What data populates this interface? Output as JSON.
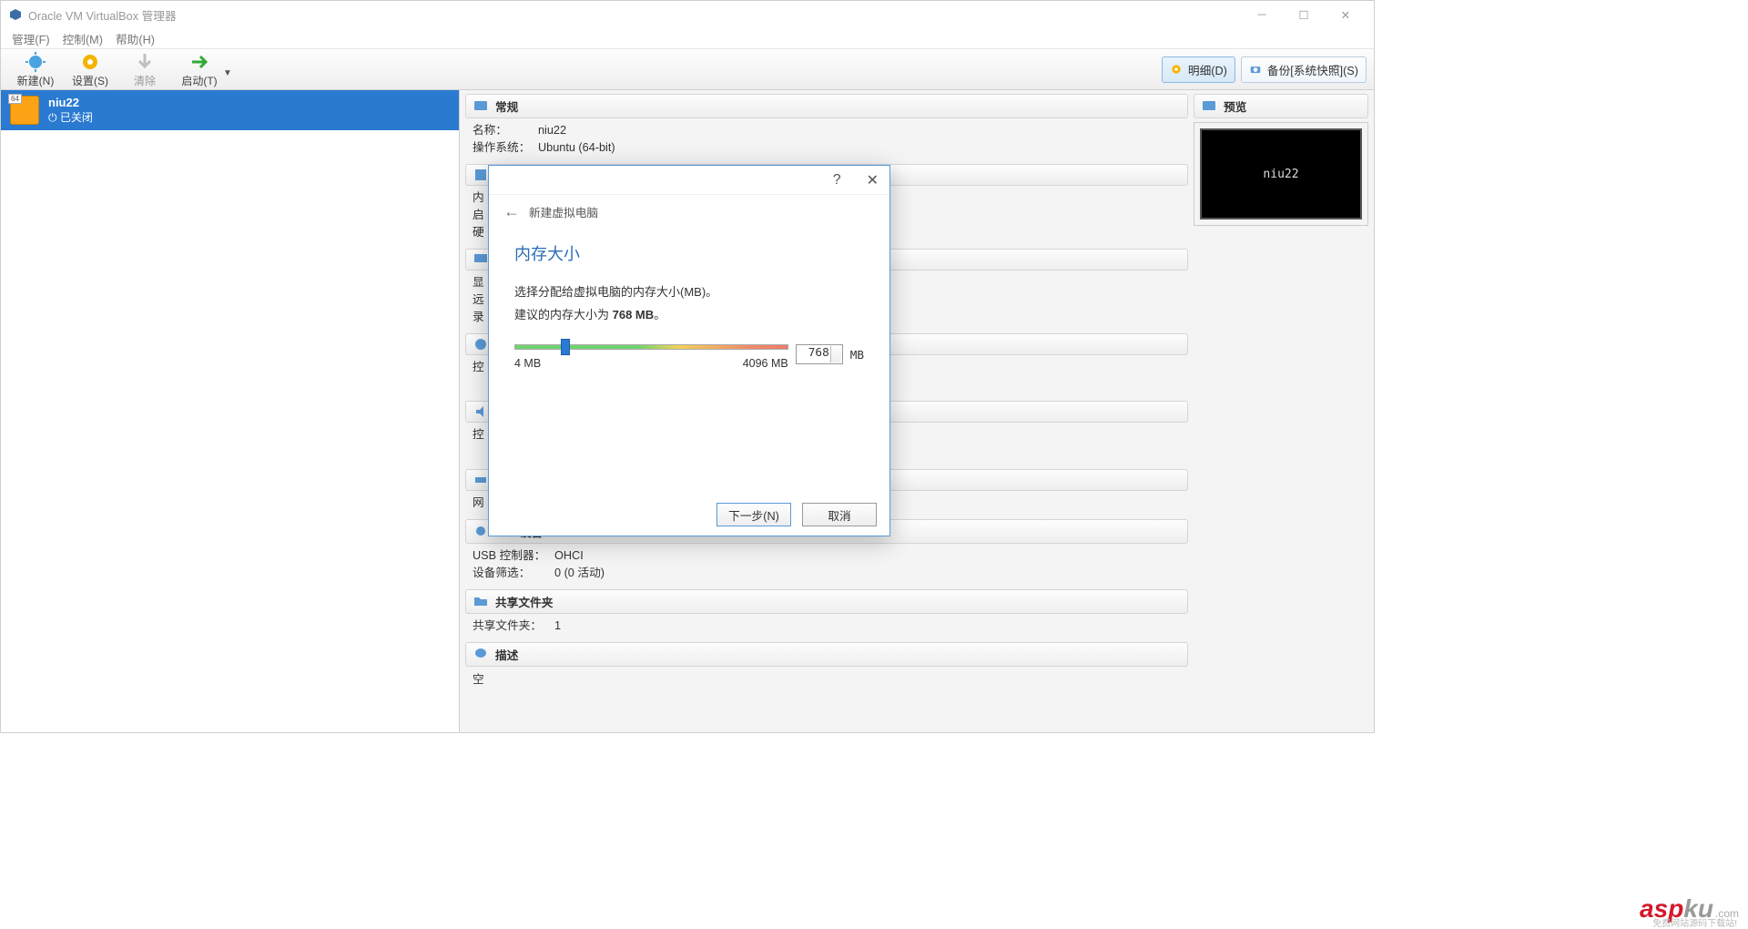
{
  "titlebar": {
    "title": "Oracle VM VirtualBox 管理器"
  },
  "menubar": {
    "items": [
      "管理(F)",
      "控制(M)",
      "帮助(H)"
    ]
  },
  "toolbar": {
    "new": "新建(N)",
    "settings": "设置(S)",
    "discard": "清除",
    "start": "启动(T)",
    "details": "明细(D)",
    "snapshots": "备份[系统快照](S)"
  },
  "vm": {
    "name": "niu22",
    "state": "⏻ 已关闭"
  },
  "general": {
    "header": "常规",
    "name_k": "名称：",
    "name_v": "niu22",
    "os_k": "操作系统：",
    "os_v": "Ubuntu (64-bit)"
  },
  "partials": {
    "sys": "内",
    "sys2": "启",
    "sys3": "硬",
    "disp": "显",
    "disp2": "远",
    "disp3": "录",
    "stor": "控",
    "aud": "控",
    "net": "网"
  },
  "usb": {
    "header": "USB设备",
    "ctrl_k": "USB 控制器：",
    "ctrl_v": "OHCI",
    "filter_k": "设备筛选：",
    "filter_v": "0 (0 活动)"
  },
  "shared": {
    "header": "共享文件夹",
    "k": "共享文件夹：",
    "v": "1"
  },
  "desc": {
    "header": "描述",
    "v": "空"
  },
  "preview": {
    "header": "预览",
    "name": "niu22"
  },
  "dialog": {
    "crumb": "新建虚拟电脑",
    "title": "内存大小",
    "line1": "选择分配给虚拟电脑的内存大小(MB)。",
    "line2a": "建议的内存大小为 ",
    "line2b": "768 MB",
    "line2c": "。",
    "min": "4 MB",
    "max": "4096 MB",
    "value": "768",
    "unit": "MB",
    "next": "下一步(N)",
    "cancel": "取消"
  },
  "watermark": {
    "a": "asp",
    "b": "ku",
    "c": ".com",
    "sub": "免费网站源码下载站!"
  }
}
